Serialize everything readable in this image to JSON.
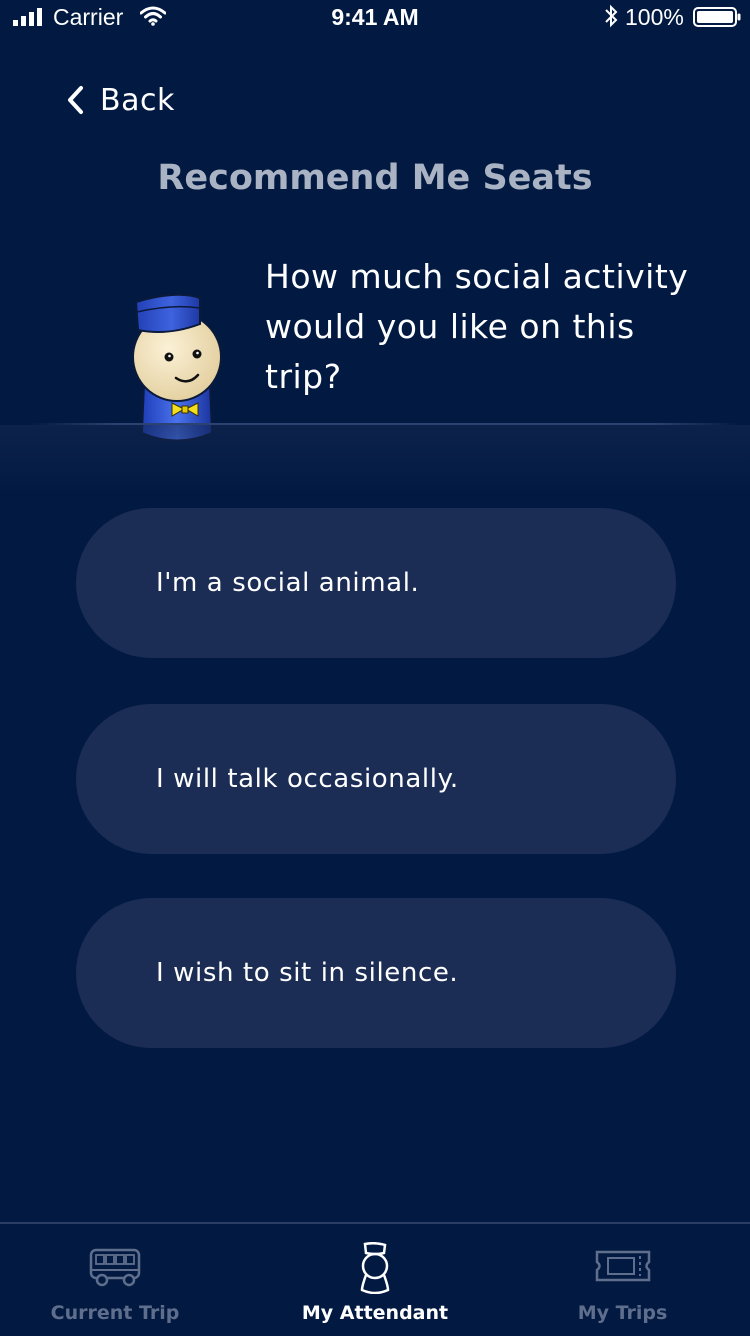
{
  "status_bar": {
    "carrier": "Carrier",
    "time": "9:41 AM",
    "battery": "100%"
  },
  "nav": {
    "back_label": "Back"
  },
  "page": {
    "title": "Recommend Me Seats",
    "question": "How much social activity would you like on this trip?"
  },
  "options": [
    {
      "label": "I'm a social animal."
    },
    {
      "label": "I will talk occasionally."
    },
    {
      "label": "I wish to sit in silence."
    }
  ],
  "tab_bar": {
    "tabs": [
      {
        "label": "Current Trip",
        "icon": "bus-icon",
        "active": false
      },
      {
        "label": "My Attendant",
        "icon": "attendant-icon",
        "active": true
      },
      {
        "label": "My Trips",
        "icon": "ticket-icon",
        "active": false
      }
    ]
  },
  "colors": {
    "background": "#021a42",
    "option_bg": "#1b2d55",
    "title": "#aab3c3",
    "tab_inactive": "#5f6e8c",
    "tab_active": "#ffffff"
  }
}
